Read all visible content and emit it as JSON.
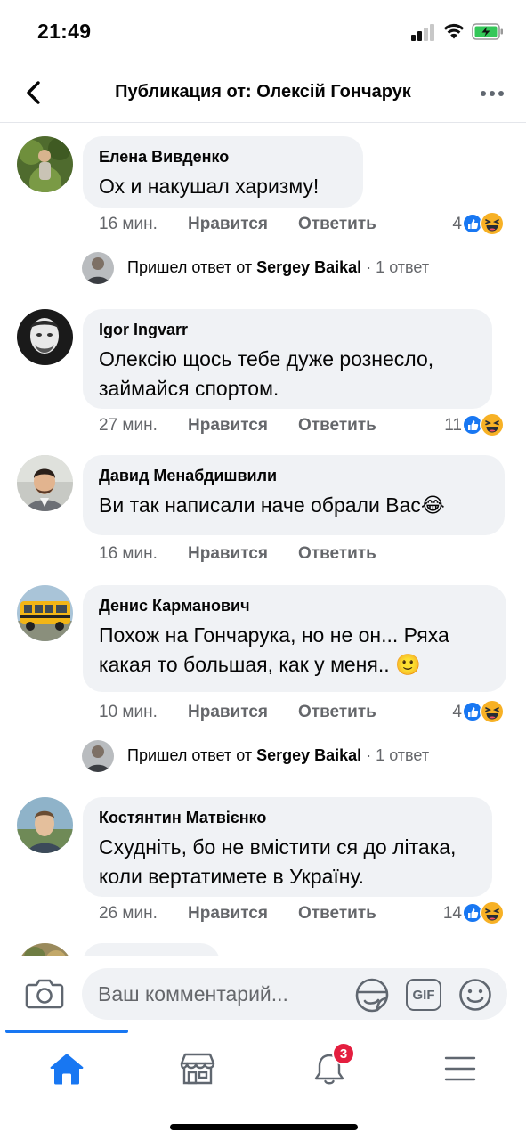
{
  "status_bar": {
    "time": "21:49"
  },
  "header": {
    "title": "Публикация от: Олексій Гончарук"
  },
  "comments": [
    {
      "author": "Елена Вивденко",
      "text": "Ох и накушал харизму!",
      "time": "16 мин.",
      "like_label": "Нравится",
      "reply_label": "Ответить",
      "reaction_count": "4",
      "reactions": [
        "like-icon",
        "haha-icon"
      ]
    },
    {
      "author": "Igor Ingvarr",
      "text": "Олексію щось тебе дуже рознесло, займайся спортом.",
      "time": "27 мин.",
      "like_label": "Нравится",
      "reply_label": "Ответить",
      "reaction_count": "11",
      "reactions": [
        "like-icon",
        "haha-icon"
      ]
    },
    {
      "author": "Давид Менабдишвили",
      "text": "Ви так написали наче обрали Вас😂",
      "time": "16 мин.",
      "like_label": "Нравится",
      "reply_label": "Ответить",
      "reaction_count": ""
    },
    {
      "author": "Денис Карманович",
      "text": "Похож на Гончарука, но не он... Ряха какая то большая, как у меня.. 🙂",
      "time": "10 мин.",
      "like_label": "Нравится",
      "reply_label": "Ответить",
      "reaction_count": "4",
      "reactions": [
        "like-icon",
        "haha-icon"
      ]
    },
    {
      "author": "Костянтин Матвієнко",
      "text": "Схудніть, бо не вмістити ся до літака, коли вертатимете в Україну.",
      "time": "26 мин.",
      "like_label": "Нравится",
      "reply_label": "Ответить",
      "reaction_count": "14",
      "reactions": [
        "like-icon",
        "haha-icon"
      ]
    }
  ],
  "reply_notices": [
    {
      "prefix": "Пришел ответ от ",
      "name": "Sergey Baikal",
      "count": " · 1 ответ"
    },
    {
      "prefix": "Пришел ответ от ",
      "name": "Sergey Baikal",
      "count": " · 1 ответ"
    }
  ],
  "composer": {
    "placeholder": "Ваш комментарий...",
    "gif_label": "GIF"
  },
  "tabs": {
    "notifications_badge": "3"
  },
  "colors": {
    "accent": "#1877f2",
    "bubble": "#f0f2f5",
    "muted_text": "#65676b",
    "badge": "#e41e3f"
  }
}
